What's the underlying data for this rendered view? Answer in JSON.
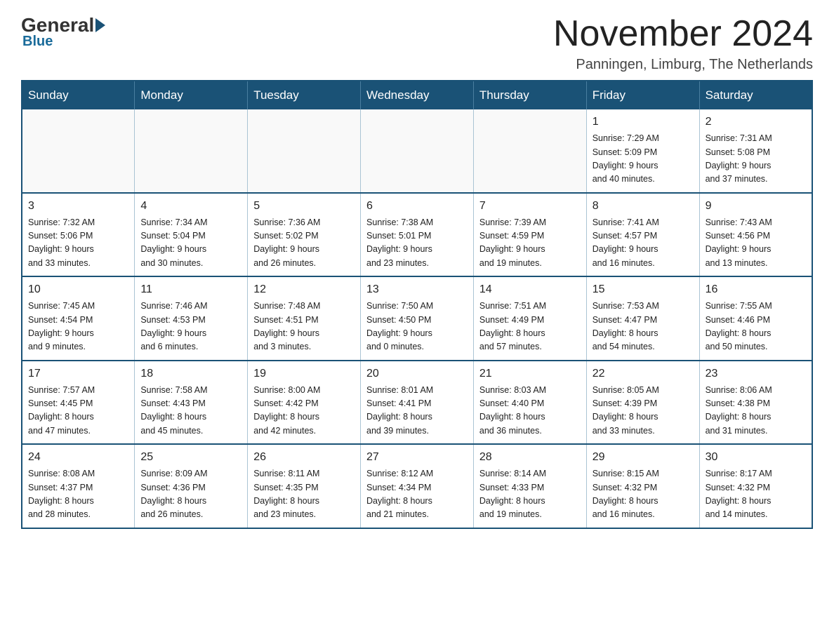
{
  "header": {
    "logo_general": "General",
    "logo_blue": "Blue",
    "month_title": "November 2024",
    "location": "Panningen, Limburg, The Netherlands"
  },
  "calendar": {
    "days_of_week": [
      "Sunday",
      "Monday",
      "Tuesday",
      "Wednesday",
      "Thursday",
      "Friday",
      "Saturday"
    ],
    "weeks": [
      [
        {
          "day": "",
          "info": ""
        },
        {
          "day": "",
          "info": ""
        },
        {
          "day": "",
          "info": ""
        },
        {
          "day": "",
          "info": ""
        },
        {
          "day": "",
          "info": ""
        },
        {
          "day": "1",
          "info": "Sunrise: 7:29 AM\nSunset: 5:09 PM\nDaylight: 9 hours\nand 40 minutes."
        },
        {
          "day": "2",
          "info": "Sunrise: 7:31 AM\nSunset: 5:08 PM\nDaylight: 9 hours\nand 37 minutes."
        }
      ],
      [
        {
          "day": "3",
          "info": "Sunrise: 7:32 AM\nSunset: 5:06 PM\nDaylight: 9 hours\nand 33 minutes."
        },
        {
          "day": "4",
          "info": "Sunrise: 7:34 AM\nSunset: 5:04 PM\nDaylight: 9 hours\nand 30 minutes."
        },
        {
          "day": "5",
          "info": "Sunrise: 7:36 AM\nSunset: 5:02 PM\nDaylight: 9 hours\nand 26 minutes."
        },
        {
          "day": "6",
          "info": "Sunrise: 7:38 AM\nSunset: 5:01 PM\nDaylight: 9 hours\nand 23 minutes."
        },
        {
          "day": "7",
          "info": "Sunrise: 7:39 AM\nSunset: 4:59 PM\nDaylight: 9 hours\nand 19 minutes."
        },
        {
          "day": "8",
          "info": "Sunrise: 7:41 AM\nSunset: 4:57 PM\nDaylight: 9 hours\nand 16 minutes."
        },
        {
          "day": "9",
          "info": "Sunrise: 7:43 AM\nSunset: 4:56 PM\nDaylight: 9 hours\nand 13 minutes."
        }
      ],
      [
        {
          "day": "10",
          "info": "Sunrise: 7:45 AM\nSunset: 4:54 PM\nDaylight: 9 hours\nand 9 minutes."
        },
        {
          "day": "11",
          "info": "Sunrise: 7:46 AM\nSunset: 4:53 PM\nDaylight: 9 hours\nand 6 minutes."
        },
        {
          "day": "12",
          "info": "Sunrise: 7:48 AM\nSunset: 4:51 PM\nDaylight: 9 hours\nand 3 minutes."
        },
        {
          "day": "13",
          "info": "Sunrise: 7:50 AM\nSunset: 4:50 PM\nDaylight: 9 hours\nand 0 minutes."
        },
        {
          "day": "14",
          "info": "Sunrise: 7:51 AM\nSunset: 4:49 PM\nDaylight: 8 hours\nand 57 minutes."
        },
        {
          "day": "15",
          "info": "Sunrise: 7:53 AM\nSunset: 4:47 PM\nDaylight: 8 hours\nand 54 minutes."
        },
        {
          "day": "16",
          "info": "Sunrise: 7:55 AM\nSunset: 4:46 PM\nDaylight: 8 hours\nand 50 minutes."
        }
      ],
      [
        {
          "day": "17",
          "info": "Sunrise: 7:57 AM\nSunset: 4:45 PM\nDaylight: 8 hours\nand 47 minutes."
        },
        {
          "day": "18",
          "info": "Sunrise: 7:58 AM\nSunset: 4:43 PM\nDaylight: 8 hours\nand 45 minutes."
        },
        {
          "day": "19",
          "info": "Sunrise: 8:00 AM\nSunset: 4:42 PM\nDaylight: 8 hours\nand 42 minutes."
        },
        {
          "day": "20",
          "info": "Sunrise: 8:01 AM\nSunset: 4:41 PM\nDaylight: 8 hours\nand 39 minutes."
        },
        {
          "day": "21",
          "info": "Sunrise: 8:03 AM\nSunset: 4:40 PM\nDaylight: 8 hours\nand 36 minutes."
        },
        {
          "day": "22",
          "info": "Sunrise: 8:05 AM\nSunset: 4:39 PM\nDaylight: 8 hours\nand 33 minutes."
        },
        {
          "day": "23",
          "info": "Sunrise: 8:06 AM\nSunset: 4:38 PM\nDaylight: 8 hours\nand 31 minutes."
        }
      ],
      [
        {
          "day": "24",
          "info": "Sunrise: 8:08 AM\nSunset: 4:37 PM\nDaylight: 8 hours\nand 28 minutes."
        },
        {
          "day": "25",
          "info": "Sunrise: 8:09 AM\nSunset: 4:36 PM\nDaylight: 8 hours\nand 26 minutes."
        },
        {
          "day": "26",
          "info": "Sunrise: 8:11 AM\nSunset: 4:35 PM\nDaylight: 8 hours\nand 23 minutes."
        },
        {
          "day": "27",
          "info": "Sunrise: 8:12 AM\nSunset: 4:34 PM\nDaylight: 8 hours\nand 21 minutes."
        },
        {
          "day": "28",
          "info": "Sunrise: 8:14 AM\nSunset: 4:33 PM\nDaylight: 8 hours\nand 19 minutes."
        },
        {
          "day": "29",
          "info": "Sunrise: 8:15 AM\nSunset: 4:32 PM\nDaylight: 8 hours\nand 16 minutes."
        },
        {
          "day": "30",
          "info": "Sunrise: 8:17 AM\nSunset: 4:32 PM\nDaylight: 8 hours\nand 14 minutes."
        }
      ]
    ]
  }
}
